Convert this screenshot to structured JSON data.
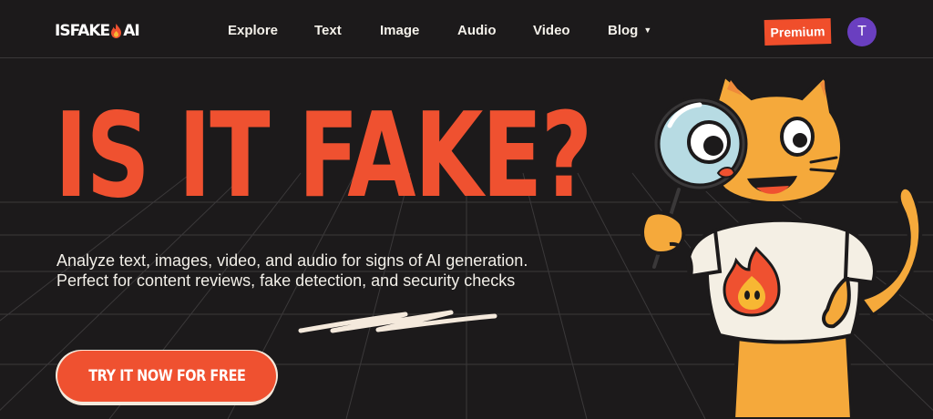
{
  "brand": {
    "logo_left": "ISFAKE",
    "logo_right": "AI",
    "accent": "#ef5130",
    "background": "#1c1a1b"
  },
  "nav": {
    "items": [
      {
        "label": "Explore"
      },
      {
        "label": "Text"
      },
      {
        "label": "Image"
      },
      {
        "label": "Audio"
      },
      {
        "label": "Video"
      },
      {
        "label": "Blog",
        "has_dropdown": true,
        "icon": "chevron-down-icon"
      }
    ],
    "premium_label": "Premium",
    "premium_color": "#f04e2b",
    "avatar_initial": "T",
    "avatar_color": "#6a3fc0"
  },
  "hero": {
    "headline": "IS IT FAKE?",
    "subtitle": "Analyze text, images, video, and audio for signs of AI generation. Perfect for content reviews, fake detection, and security checks",
    "cta_label": "TRY IT NOW FOR FREE",
    "mascot": "cat-with-magnifying-glass-illustration"
  }
}
